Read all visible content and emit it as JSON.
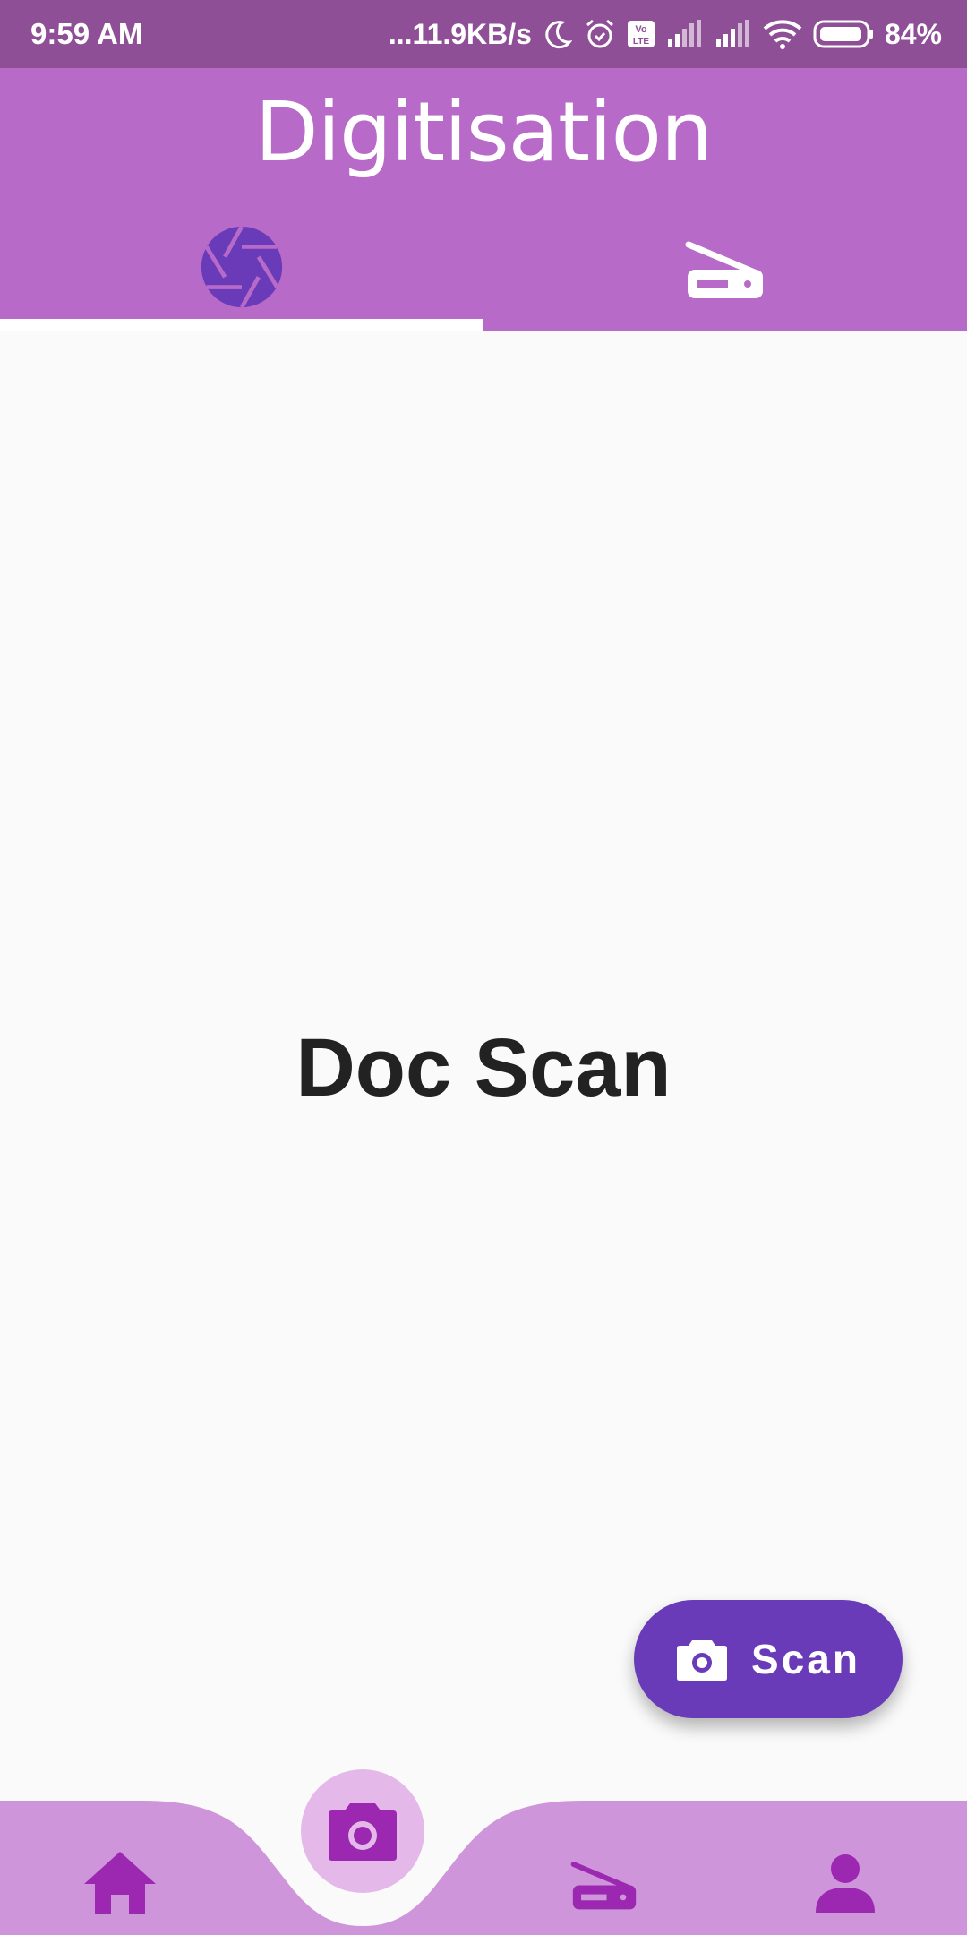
{
  "status_bar": {
    "time": "9:59 AM",
    "network_speed": "...11.9KB/s",
    "battery": "84%",
    "icons": [
      "moon-icon",
      "alarm-icon",
      "volte-icon",
      "signal-icon",
      "signal-icon",
      "wifi-icon",
      "battery-icon"
    ]
  },
  "app_bar": {
    "title": "Digitisation",
    "tabs": [
      {
        "icon": "aperture-icon",
        "selected": true
      },
      {
        "icon": "scanner-icon",
        "selected": false
      }
    ]
  },
  "main": {
    "heading": "Doc Scan"
  },
  "fab": {
    "label": "Scan",
    "icon": "camera-icon"
  },
  "bottom_nav": {
    "items": [
      {
        "icon": "home-icon"
      },
      {
        "icon": "camera-icon",
        "selected": true
      },
      {
        "icon": "scanner-icon"
      },
      {
        "icon": "person-icon"
      }
    ]
  },
  "colors": {
    "status_bar": "#8e4f96",
    "app_bar": "#b86ac8",
    "fab": "#6a3bb8",
    "bottom_nav": "#ce95da",
    "nav_icon": "#9c27b0"
  }
}
